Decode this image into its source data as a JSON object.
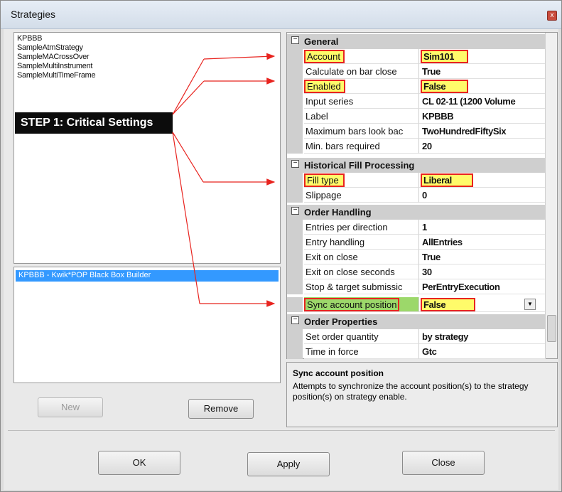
{
  "window": {
    "title": "Strategies",
    "close_glyph": "x"
  },
  "strategies": [
    "KPBBB",
    "SampleAtmStrategy",
    "SampleMACrossOver",
    "SampleMultiInstrument",
    "SampleMultiTimeFrame"
  ],
  "annotation": {
    "step_label": "STEP 1: Critical Settings",
    "arrow_color": "#e8241f",
    "highlight_color": "#fffb6a"
  },
  "instances": [
    "KPBBB - Kwik*POP Black Box Builder"
  ],
  "buttons": {
    "new": "New",
    "remove": "Remove",
    "ok": "OK",
    "apply": "Apply",
    "close": "Close"
  },
  "properties": {
    "general": {
      "header": "General",
      "rows": [
        {
          "name": "Account",
          "value": "Sim101"
        },
        {
          "name": "Calculate on bar close",
          "value": "True"
        },
        {
          "name": "Enabled",
          "value": "False"
        },
        {
          "name": "Input series",
          "value": "CL 02-11 (1200 Volume"
        },
        {
          "name": "Label",
          "value": "KPBBB"
        },
        {
          "name": "Maximum bars look bac",
          "value": "TwoHundredFiftySix"
        },
        {
          "name": "Min. bars required",
          "value": "20"
        }
      ]
    },
    "fill": {
      "header": "Historical Fill Processing",
      "rows": [
        {
          "name": "Fill type",
          "value": "Liberal"
        },
        {
          "name": "Slippage",
          "value": "0"
        }
      ]
    },
    "order": {
      "header": "Order Handling",
      "rows": [
        {
          "name": "Entries per direction",
          "value": "1"
        },
        {
          "name": "Entry handling",
          "value": "AllEntries"
        },
        {
          "name": "Exit on close",
          "value": "True"
        },
        {
          "name": "Exit on close seconds",
          "value": "30"
        },
        {
          "name": "Stop & target submissic",
          "value": "PerEntryExecution"
        },
        {
          "name": "Sync account position",
          "value": "False"
        }
      ]
    },
    "orderprops": {
      "header": "Order Properties",
      "rows": [
        {
          "name": "Set order quantity",
          "value": "by strategy"
        },
        {
          "name": "Time in force",
          "value": "Gtc"
        }
      ]
    }
  },
  "description": {
    "title": "Sync account position",
    "text": "Attempts to synchronize the account position(s) to the strategy position(s) on strategy enable."
  }
}
